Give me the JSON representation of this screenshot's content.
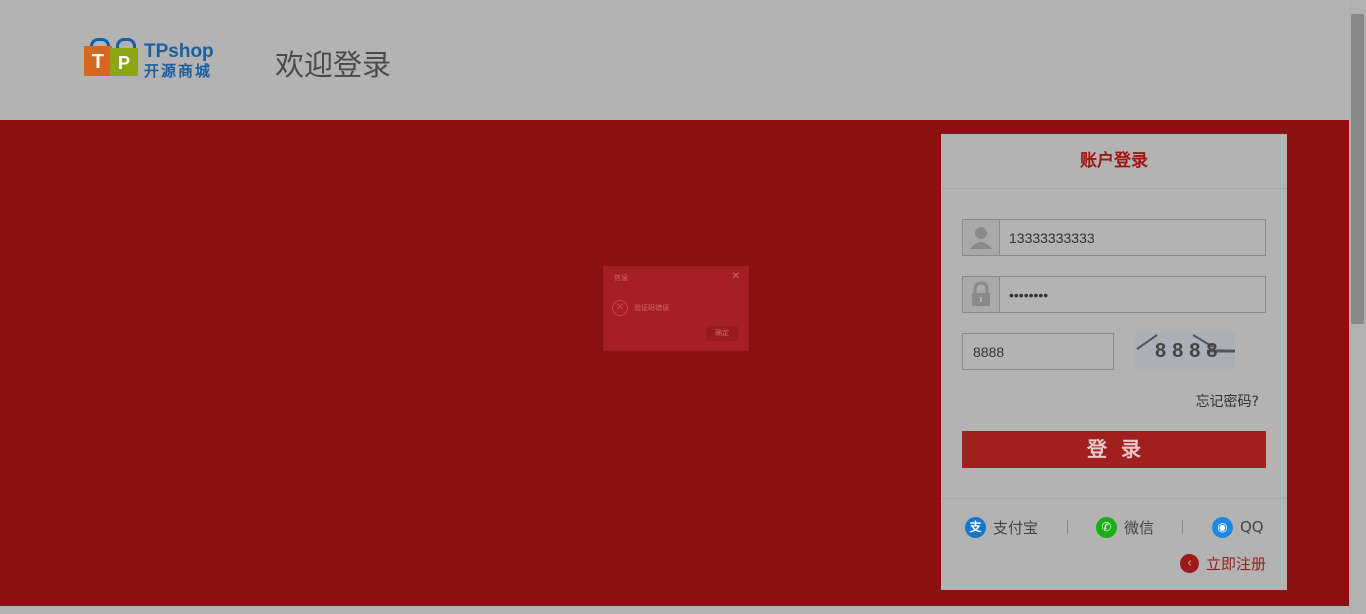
{
  "header": {
    "logo_text": "TPshop",
    "logo_sub": "开源商城",
    "logo_bag_letters": [
      "T",
      "P"
    ],
    "welcome": "欢迎登录"
  },
  "login_panel": {
    "title": "账户登录",
    "username_value": "13333333333",
    "password_value": "••••••••",
    "code_value": "8888",
    "captcha_text": "8888",
    "forgot": "忘记密码?",
    "login_button": "登录",
    "social": [
      {
        "label": "支付宝",
        "icon": "alipay-icon",
        "glyph": "支",
        "color": "#1677cf"
      },
      {
        "label": "微信",
        "icon": "wechat-icon",
        "glyph": "✆",
        "color": "#1aad19"
      },
      {
        "label": "QQ",
        "icon": "qq-icon",
        "glyph": "◉",
        "color": "#1e88e5"
      }
    ],
    "register": "立即注册"
  },
  "dialog": {
    "title": "信息",
    "message": "验证码错误",
    "button": "确定",
    "close_glyph": "✕",
    "error_glyph": "✕"
  },
  "colors": {
    "overlay": "#b3b3b3",
    "banner": "#8b1111",
    "accent": "#a21f1f"
  }
}
